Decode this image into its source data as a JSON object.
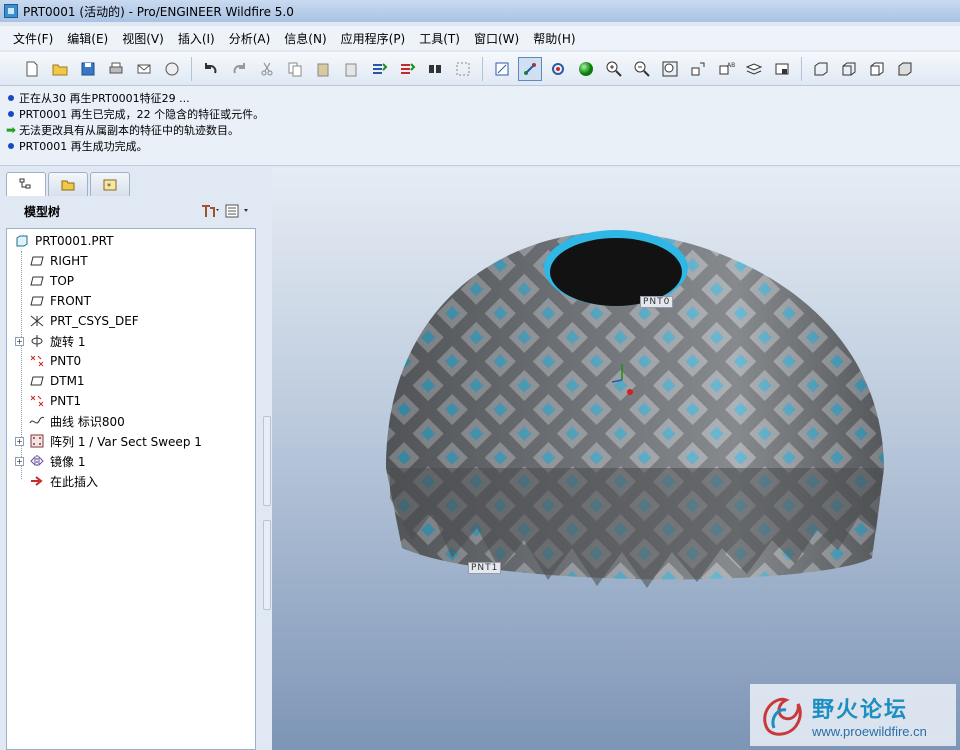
{
  "window": {
    "title": "PRT0001 (活动的) - Pro/ENGINEER Wildfire 5.0"
  },
  "menu": [
    "文件(F)",
    "编辑(E)",
    "视图(V)",
    "插入(I)",
    "分析(A)",
    "信息(N)",
    "应用程序(P)",
    "工具(T)",
    "窗口(W)",
    "帮助(H)"
  ],
  "messages": [
    {
      "type": "info",
      "text": "正在从30 再生PRT0001特征29 ..."
    },
    {
      "type": "info",
      "text": "PRT0001 再生已完成，22 个隐含的特征或元件。"
    },
    {
      "type": "warning",
      "text": "无法更改具有从属副本的特征中的轨迹数目。"
    },
    {
      "type": "info",
      "text": "PRT0001 再生成功完成。"
    }
  ],
  "tree": {
    "header": "模型树",
    "nodes": [
      {
        "label": "PRT0001.PRT",
        "icon": "part-icon",
        "expand": false,
        "root": true
      },
      {
        "label": "RIGHT",
        "icon": "datum-plane-icon",
        "expand": false
      },
      {
        "label": "TOP",
        "icon": "datum-plane-icon",
        "expand": false
      },
      {
        "label": "FRONT",
        "icon": "datum-plane-icon",
        "expand": false
      },
      {
        "label": "PRT_CSYS_DEF",
        "icon": "csys-icon",
        "expand": false
      },
      {
        "label": "旋转 1",
        "icon": "revolve-icon",
        "expand": true
      },
      {
        "label": "PNT0",
        "icon": "datum-point-icon",
        "expand": false
      },
      {
        "label": "DTM1",
        "icon": "datum-plane-icon",
        "expand": false
      },
      {
        "label": "PNT1",
        "icon": "datum-point-icon",
        "expand": false
      },
      {
        "label": "曲线 标识800",
        "icon": "curve-icon",
        "expand": false
      },
      {
        "label": "阵列 1 / Var Sect Sweep 1",
        "icon": "pattern-icon",
        "expand": true
      },
      {
        "label": "镜像 1",
        "icon": "mirror-icon",
        "expand": true
      },
      {
        "label": "在此插入",
        "icon": "insert-here-icon",
        "expand": false
      }
    ]
  },
  "viewport": {
    "point_labels": [
      "PNT0",
      "PNT1"
    ]
  },
  "watermark": {
    "title": "野火论坛",
    "url": "www.proewildfire.cn"
  },
  "colors": {
    "model_gray": "#6c6e70",
    "model_cyan": "#2fb8e6"
  }
}
